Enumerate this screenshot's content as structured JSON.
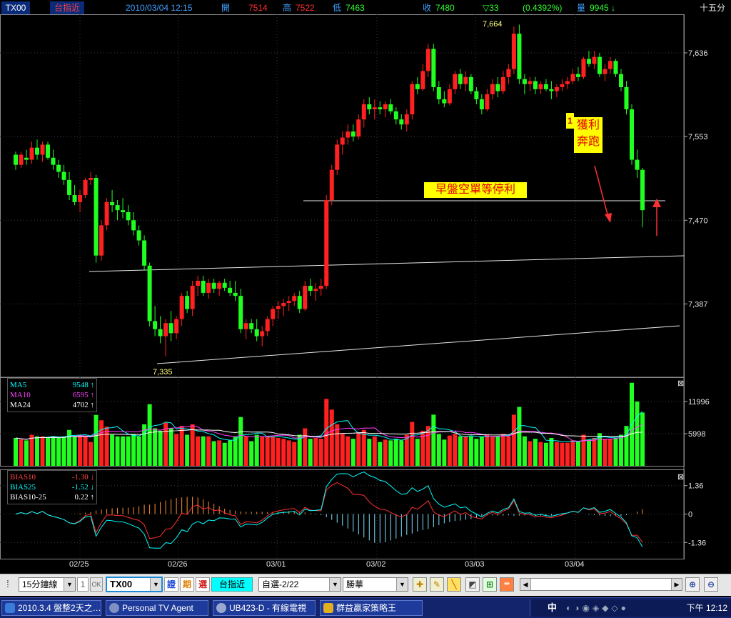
{
  "header": {
    "symbol": "TX00",
    "name": "台指近",
    "datetime": "2010/03/04 12:15",
    "open_label": "開",
    "open_value": "7514",
    "high_label": "高",
    "high_value": "7522",
    "low_label": "低",
    "low_value": "7463",
    "close_label": "收",
    "close_value": "7480",
    "change": "▽33",
    "change_pct": "(0.4392%)",
    "volume_label": "量",
    "volume_value": "9945",
    "volume_arrow": "↓",
    "period": "十五分"
  },
  "price_axis": {
    "labels": [
      "7,636",
      "7,553",
      "7,470",
      "7,387"
    ],
    "values": [
      7636,
      7553,
      7470,
      7387
    ],
    "min": 7320,
    "max": 7670
  },
  "annotations": {
    "high_mark": "7,664",
    "low_mark": "7,335",
    "note1_num": "1",
    "note1_text_a": "獲利",
    "note1_text_b": "奔跑",
    "note2_text": "早盤空單等停利"
  },
  "volume_panel": {
    "legend": [
      {
        "name": "MA5",
        "value": "9548",
        "arrow": "↑",
        "color": "#00ffff"
      },
      {
        "name": "MA10",
        "value": "6595",
        "arrow": "↑",
        "color": "#ff40ff"
      },
      {
        "name": "MA24",
        "value": "4702",
        "arrow": "↑",
        "color": "#ffffff"
      }
    ],
    "axis_labels": [
      "11996",
      "5998"
    ],
    "axis_values": [
      11996,
      5998
    ],
    "max": 16000
  },
  "bias_panel": {
    "legend": [
      {
        "name": "BIAS10",
        "value": "-1.30",
        "arrow": "↓",
        "color": "#ff4040"
      },
      {
        "name": "BIAS25",
        "value": "-1.52",
        "arrow": "↓",
        "color": "#00ffff"
      },
      {
        "name": "BIAS10-25",
        "value": "0.22",
        "arrow": "↑",
        "color": "#ffffff"
      }
    ],
    "axis_labels": [
      "1.36",
      "0",
      "-1.36"
    ],
    "axis_values": [
      1.36,
      0,
      -1.36
    ],
    "range": 2.0
  },
  "x_axis": {
    "labels": [
      "02/25",
      "02/26",
      "03/01",
      "03/02",
      "03/03",
      "03/04"
    ]
  },
  "toolbar": {
    "interval": "15分鐘線",
    "interval_num": "1",
    "ok_label": "OK",
    "symbol": "TX00",
    "btn_zheng": "證",
    "btn_qi": "期",
    "btn_xuan": "選",
    "quote_name": "台指近",
    "watchlist": "自選-2/22",
    "broker": "勝華"
  },
  "taskbar": {
    "items": [
      "2010.3.4 盤整2天之…",
      "Personal TV Agent",
      "UB423-D - 有線電視",
      "群益贏家策略王"
    ],
    "ime": "中",
    "clock": "下午 12:12"
  },
  "chart_data": {
    "type": "candlestick",
    "period": "15 min",
    "candles": [
      [
        7535,
        7538,
        7520,
        7525
      ],
      [
        7525,
        7538,
        7522,
        7535
      ],
      [
        7532,
        7540,
        7525,
        7530
      ],
      [
        7530,
        7548,
        7526,
        7542
      ],
      [
        7542,
        7550,
        7530,
        7535
      ],
      [
        7535,
        7548,
        7528,
        7545
      ],
      [
        7545,
        7548,
        7530,
        7532
      ],
      [
        7532,
        7540,
        7520,
        7525
      ],
      [
        7525,
        7530,
        7512,
        7518
      ],
      [
        7518,
        7525,
        7505,
        7510
      ],
      [
        7510,
        7518,
        7490,
        7495
      ],
      [
        7495,
        7505,
        7485,
        7488
      ],
      [
        7488,
        7500,
        7478,
        7495
      ],
      [
        7495,
        7512,
        7492,
        7510
      ],
      [
        7510,
        7518,
        7505,
        7512
      ],
      [
        7512,
        7515,
        7428,
        7435
      ],
      [
        7435,
        7470,
        7430,
        7465
      ],
      [
        7465,
        7492,
        7460,
        7488
      ],
      [
        7488,
        7500,
        7478,
        7485
      ],
      [
        7485,
        7490,
        7470,
        7480
      ],
      [
        7480,
        7492,
        7472,
        7478
      ],
      [
        7478,
        7485,
        7465,
        7470
      ],
      [
        7470,
        7478,
        7455,
        7460
      ],
      [
        7460,
        7465,
        7445,
        7450
      ],
      [
        7450,
        7455,
        7420,
        7425
      ],
      [
        7425,
        7428,
        7365,
        7370
      ],
      [
        7370,
        7385,
        7355,
        7362
      ],
      [
        7362,
        7375,
        7348,
        7355
      ],
      [
        7355,
        7372,
        7335,
        7368
      ],
      [
        7368,
        7380,
        7350,
        7358
      ],
      [
        7358,
        7375,
        7352,
        7372
      ],
      [
        7372,
        7398,
        7365,
        7395
      ],
      [
        7395,
        7400,
        7378,
        7382
      ],
      [
        7382,
        7410,
        7375,
        7405
      ],
      [
        7405,
        7415,
        7395,
        7410
      ],
      [
        7410,
        7415,
        7395,
        7398
      ],
      [
        7398,
        7412,
        7392,
        7408
      ],
      [
        7408,
        7412,
        7398,
        7402
      ],
      [
        7402,
        7410,
        7395,
        7408
      ],
      [
        7408,
        7412,
        7400,
        7403
      ],
      [
        7403,
        7410,
        7395,
        7398
      ],
      [
        7398,
        7410,
        7390,
        7395
      ],
      [
        7395,
        7402,
        7358,
        7362
      ],
      [
        7362,
        7372,
        7352,
        7368
      ],
      [
        7368,
        7372,
        7358,
        7362
      ],
      [
        7362,
        7372,
        7350,
        7355
      ],
      [
        7355,
        7365,
        7345,
        7360
      ],
      [
        7360,
        7375,
        7355,
        7372
      ],
      [
        7372,
        7385,
        7365,
        7382
      ],
      [
        7382,
        7390,
        7372,
        7385
      ],
      [
        7385,
        7392,
        7375,
        7388
      ],
      [
        7388,
        7395,
        7380,
        7390
      ],
      [
        7390,
        7398,
        7385,
        7395
      ],
      [
        7395,
        7400,
        7378,
        7382
      ],
      [
        7382,
        7410,
        7380,
        7405
      ],
      [
        7405,
        7412,
        7395,
        7400
      ],
      [
        7400,
        7408,
        7390,
        7402
      ],
      [
        7402,
        7412,
        7395,
        7405
      ],
      [
        7405,
        7495,
        7402,
        7490
      ],
      [
        7490,
        7525,
        7485,
        7520
      ],
      [
        7520,
        7550,
        7515,
        7545
      ],
      [
        7545,
        7558,
        7535,
        7552
      ],
      [
        7552,
        7565,
        7545,
        7558
      ],
      [
        7558,
        7565,
        7548,
        7553
      ],
      [
        7553,
        7575,
        7550,
        7570
      ],
      [
        7570,
        7590,
        7562,
        7585
      ],
      [
        7585,
        7592,
        7575,
        7580
      ],
      [
        7580,
        7590,
        7570,
        7582
      ],
      [
        7582,
        7588,
        7575,
        7580
      ],
      [
        7580,
        7588,
        7572,
        7585
      ],
      [
        7585,
        7590,
        7575,
        7578
      ],
      [
        7578,
        7582,
        7565,
        7570
      ],
      [
        7570,
        7575,
        7560,
        7565
      ],
      [
        7565,
        7580,
        7558,
        7575
      ],
      [
        7575,
        7608,
        7570,
        7605
      ],
      [
        7605,
        7612,
        7595,
        7600
      ],
      [
        7600,
        7625,
        7598,
        7618
      ],
      [
        7618,
        7645,
        7612,
        7640
      ],
      [
        7640,
        7645,
        7598,
        7602
      ],
      [
        7602,
        7608,
        7585,
        7590
      ],
      [
        7590,
        7598,
        7582,
        7586
      ],
      [
        7586,
        7605,
        7584,
        7600
      ],
      [
        7600,
        7618,
        7595,
        7615
      ],
      [
        7615,
        7620,
        7600,
        7605
      ],
      [
        7605,
        7618,
        7598,
        7612
      ],
      [
        7612,
        7615,
        7595,
        7598
      ],
      [
        7598,
        7602,
        7585,
        7590
      ],
      [
        7590,
        7595,
        7575,
        7580
      ],
      [
        7580,
        7600,
        7578,
        7595
      ],
      [
        7595,
        7610,
        7590,
        7605
      ],
      [
        7605,
        7612,
        7592,
        7598
      ],
      [
        7598,
        7618,
        7595,
        7612
      ],
      [
        7612,
        7625,
        7605,
        7620
      ],
      [
        7620,
        7662,
        7615,
        7655
      ],
      [
        7655,
        7664,
        7605,
        7610
      ],
      [
        7610,
        7615,
        7595,
        7605
      ],
      [
        7605,
        7612,
        7598,
        7608
      ],
      [
        7608,
        7612,
        7595,
        7600
      ],
      [
        7600,
        7608,
        7595,
        7605
      ],
      [
        7605,
        7610,
        7598,
        7600
      ],
      [
        7600,
        7608,
        7590,
        7598
      ],
      [
        7598,
        7605,
        7592,
        7602
      ],
      [
        7602,
        7610,
        7598,
        7605
      ],
      [
        7605,
        7612,
        7600,
        7608
      ],
      [
        7608,
        7620,
        7605,
        7615
      ],
      [
        7615,
        7622,
        7608,
        7612
      ],
      [
        7612,
        7632,
        7610,
        7630
      ],
      [
        7630,
        7638,
        7622,
        7625
      ],
      [
        7625,
        7638,
        7620,
        7632
      ],
      [
        7632,
        7636,
        7612,
        7615
      ],
      [
        7615,
        7625,
        7608,
        7620
      ],
      [
        7620,
        7632,
        7615,
        7628
      ],
      [
        7628,
        7630,
        7612,
        7615
      ],
      [
        7615,
        7620,
        7598,
        7602
      ],
      [
        7602,
        7608,
        7575,
        7580
      ],
      [
        7580,
        7585,
        7525,
        7530
      ],
      [
        7530,
        7540,
        7512,
        7520
      ],
      [
        7520,
        7522,
        7463,
        7480
      ]
    ]
  }
}
